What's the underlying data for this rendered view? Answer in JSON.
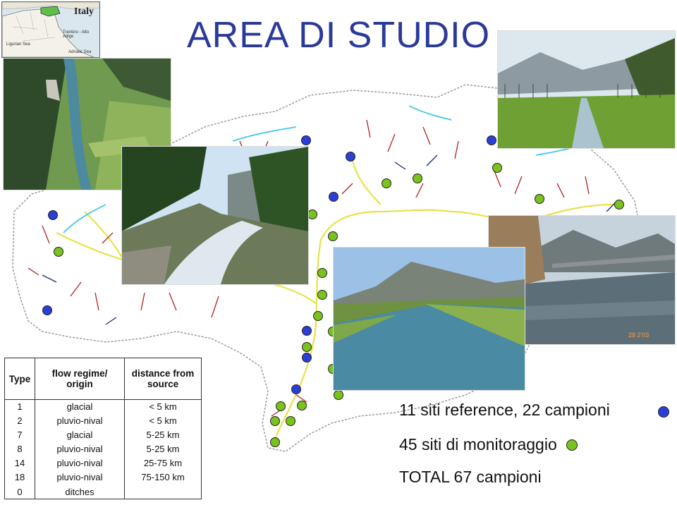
{
  "slide": {
    "title": "AREA DI STUDIO"
  },
  "inset_map": {
    "title": "Italy",
    "labels": [
      "Trentino - Alto Adige",
      "Ligurian Sea",
      "Adriatic Sea"
    ]
  },
  "table": {
    "headers": [
      "Type",
      "flow regime/ origin",
      "distance from source"
    ],
    "rows": [
      [
        "1",
        "glacial",
        "< 5 km"
      ],
      [
        "2",
        "pluvio-nival",
        "< 5 km"
      ],
      [
        "7",
        "glacial",
        "5-25 km"
      ],
      [
        "8",
        "pluvio-nival",
        "5-25 km"
      ],
      [
        "14",
        "pluvio-nival",
        "25-75 km"
      ],
      [
        "18",
        "pluvio-nival",
        "75-150 km"
      ],
      [
        "0",
        "ditches",
        ""
      ]
    ]
  },
  "summary": {
    "reference": "11 siti reference, 22 campioni",
    "monitoring": "45 siti di monitoraggio",
    "total": "TOTAL 67 campioni"
  },
  "colors": {
    "title": "#2b3a9a",
    "reference_marker": "#2b3fd6",
    "monitoring_marker": "#7ac21e",
    "river_main": "#e8e24a",
    "river_glacial": "#3cc8e6",
    "river_red": "#b52020",
    "river_dark": "#1c2a7a"
  }
}
